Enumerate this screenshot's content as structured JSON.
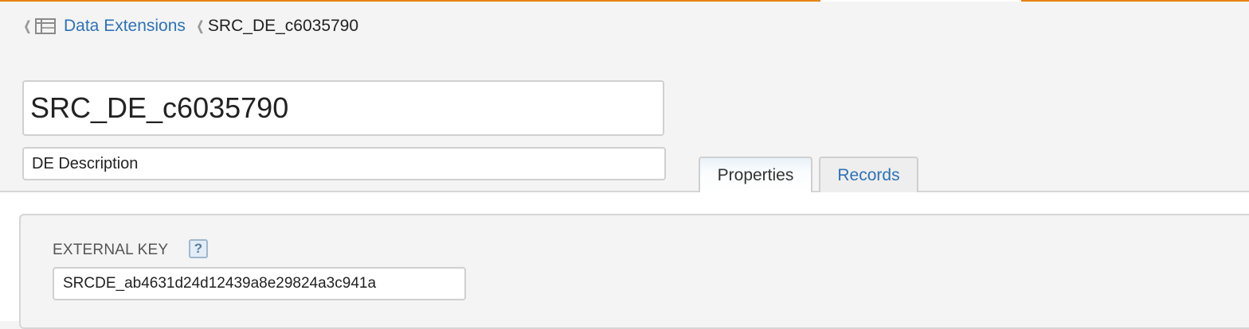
{
  "colors": {
    "accent": "#e8830f",
    "accent_gap": "#ffffff",
    "link": "#2d72b8"
  },
  "breadcrumb": {
    "icon": "table-icon",
    "parent_label": "Data Extensions",
    "current_label": "SRC_DE_c6035790"
  },
  "form": {
    "name_value": "SRC_DE_c6035790",
    "description_value": "DE Description"
  },
  "tabs": [
    {
      "label": "Properties",
      "active": true
    },
    {
      "label": "Records",
      "active": false
    }
  ],
  "properties": {
    "external_key_label": "EXTERNAL KEY",
    "help_icon": "?",
    "external_key_value": "SRCDE_ab4631d24d12439a8e29824a3c941a"
  }
}
